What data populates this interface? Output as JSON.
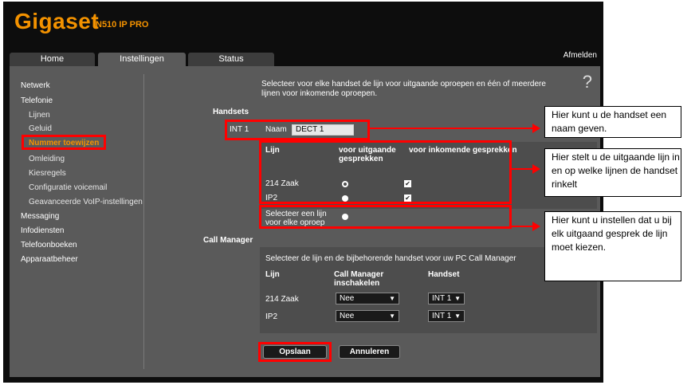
{
  "brand": {
    "logo": "Gigaset",
    "model": "N510 IP PRO",
    "accent": "#f39200"
  },
  "tabs": [
    {
      "label": "Home"
    },
    {
      "label": "Instellingen"
    },
    {
      "label": "Status"
    }
  ],
  "logout": "Afmelden",
  "help": "?",
  "sidebar": {
    "items": [
      {
        "label": "Netwerk"
      },
      {
        "label": "Telefonie"
      },
      {
        "label": "Lijnen"
      },
      {
        "label": "Geluid"
      },
      {
        "label": "Nummer toewijzen"
      },
      {
        "label": "Omleiding"
      },
      {
        "label": "Kiesregels"
      },
      {
        "label": "Configuratie voicemail"
      },
      {
        "label": "Geavanceerde VoIP-instellingen"
      },
      {
        "label": "Messaging"
      },
      {
        "label": "Infodiensten"
      },
      {
        "label": "Telefoonboeken"
      },
      {
        "label": "Apparaatbeheer"
      }
    ]
  },
  "main": {
    "intro": "Selecteer voor elke handset de lijn voor uitgaande oproepen en één of meerdere lijnen voor inkomende oproepen.",
    "handsets_heading": "Handsets",
    "handset_id": "INT 1",
    "name_label": "Naam",
    "name_value": "DECT 1",
    "columns": {
      "line": "Lijn",
      "outgoing": "voor uitgaande gesprekken",
      "incoming": "voor inkomende gesprekken"
    },
    "lines": [
      {
        "name": "214 Zaak",
        "outgoing_selected": true,
        "incoming_checked": true
      },
      {
        "name": "IP2",
        "outgoing_selected": false,
        "incoming_checked": true
      }
    ],
    "select_per_call": "Selecteer een lijn voor elke oproep",
    "call_manager_heading": "Call Manager",
    "call_manager_intro": "Selecteer de lijn en de bijbehorende handset voor uw PC Call Manager",
    "cm_columns": {
      "line": "Lijn",
      "enable": "Call Manager inschakelen",
      "handset": "Handset"
    },
    "cm_rows": [
      {
        "line": "214 Zaak",
        "enable": "Nee",
        "handset": "INT 1"
      },
      {
        "line": "IP2",
        "enable": "Nee",
        "handset": "INT 1"
      }
    ],
    "save": "Opslaan",
    "cancel": "Annuleren"
  },
  "callouts": [
    "Hier kunt u de handset een naam geven.",
    "Hier stelt u de uitgaande lijn in en op welke lijnen de handset rinkelt",
    "Hier kunt u instellen dat u bij elk uitgaand gesprek de lijn moet kiezen."
  ],
  "icons": {
    "check": "✔",
    "dropdown": "▼"
  }
}
